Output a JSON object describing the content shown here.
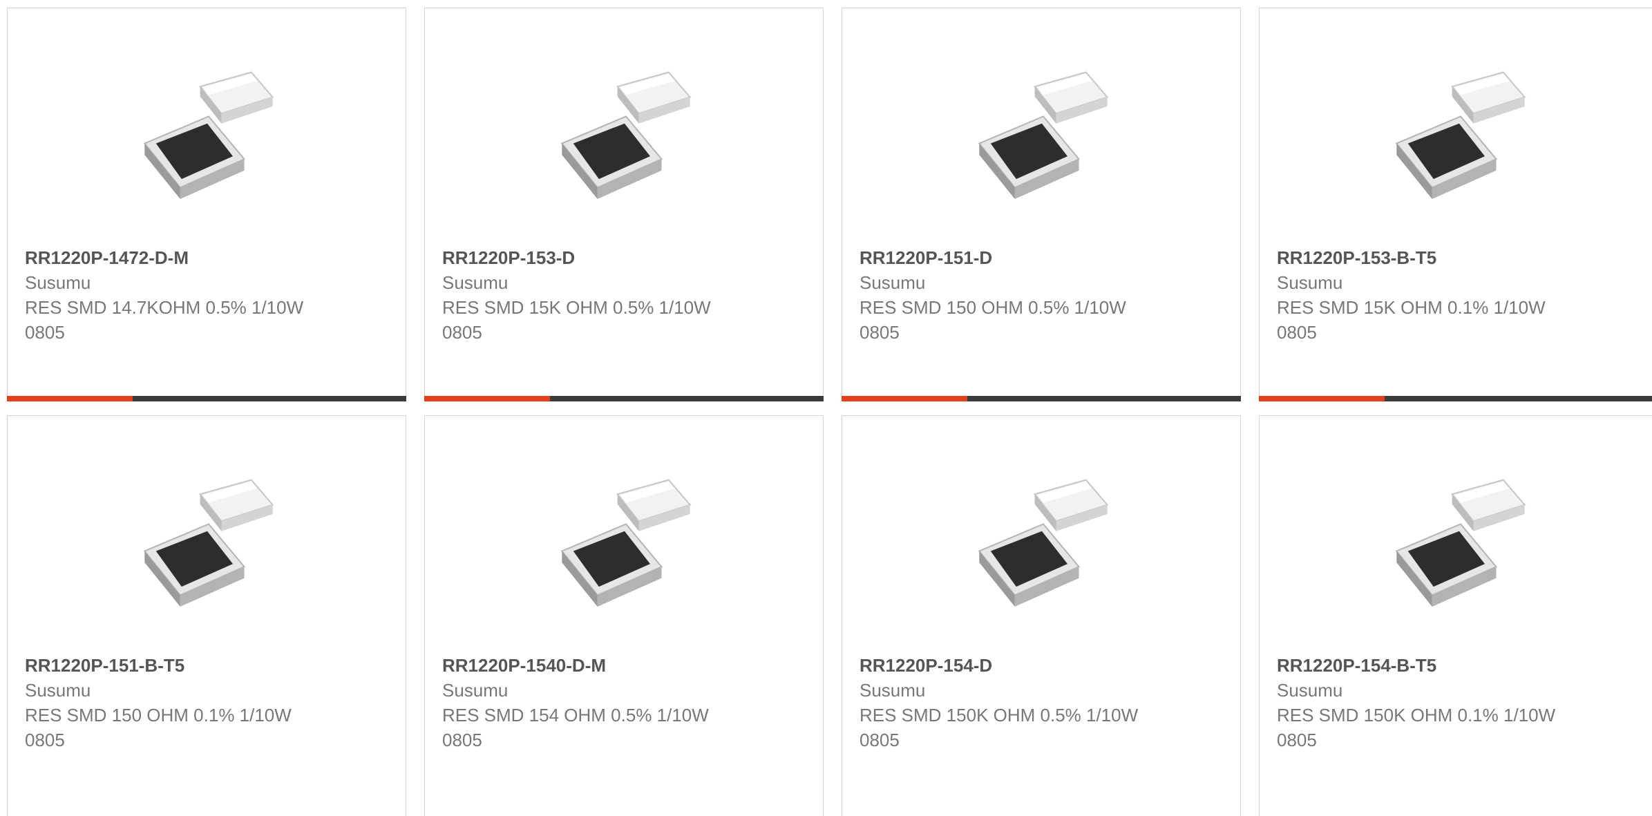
{
  "products": [
    {
      "part": "RR1220P-1472-D-M",
      "mfr": "Susumu",
      "desc": "RES SMD 14.7KOHM 0.5% 1/10W 0805"
    },
    {
      "part": "RR1220P-153-D",
      "mfr": "Susumu",
      "desc": "RES SMD 15K OHM 0.5% 1/10W 0805"
    },
    {
      "part": "RR1220P-151-D",
      "mfr": "Susumu",
      "desc": "RES SMD 150 OHM 0.5% 1/10W 0805"
    },
    {
      "part": "RR1220P-153-B-T5",
      "mfr": "Susumu",
      "desc": "RES SMD 15K OHM 0.1% 1/10W 0805"
    },
    {
      "part": "RR1220P-151-B-T5",
      "mfr": "Susumu",
      "desc": "RES SMD 150 OHM 0.1% 1/10W 0805"
    },
    {
      "part": "RR1220P-1540-D-M",
      "mfr": "Susumu",
      "desc": "RES SMD 154 OHM 0.5% 1/10W 0805"
    },
    {
      "part": "RR1220P-154-D",
      "mfr": "Susumu",
      "desc": "RES SMD 150K OHM 0.5% 1/10W 0805"
    },
    {
      "part": "RR1220P-154-B-T5",
      "mfr": "Susumu",
      "desc": "RES SMD 150K OHM 0.1% 1/10W 0805"
    }
  ],
  "colors": {
    "accent": "#e0401c",
    "bar": "#3a3a3a",
    "border": "#d6d6d6"
  },
  "icon": "resistor-chip-image"
}
